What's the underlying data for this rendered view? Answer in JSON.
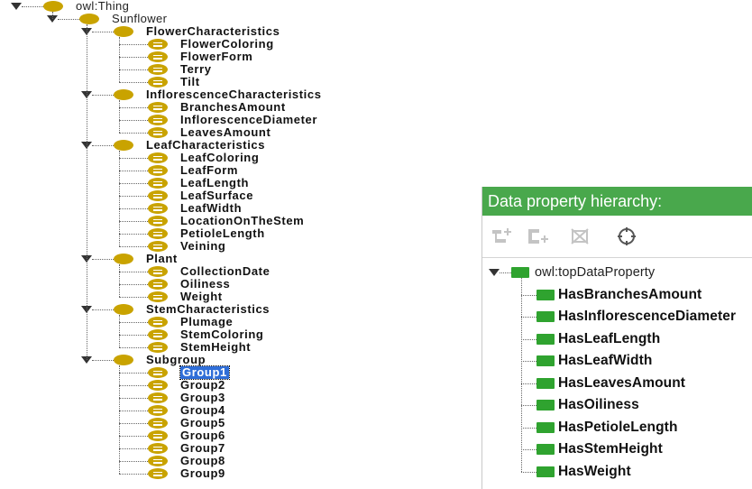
{
  "class_hierarchy": {
    "root": {
      "label": "owl:Thing"
    },
    "child": {
      "label": "Sunflower"
    },
    "groups": [
      {
        "label": "FlowerCharacteristics",
        "items": [
          "FlowerColoring",
          "FlowerForm",
          "Terry",
          "Tilt"
        ]
      },
      {
        "label": "InflorescenceCharacteristics",
        "items": [
          "BranchesAmount",
          "InflorescenceDiameter",
          "LeavesAmount"
        ]
      },
      {
        "label": "LeafCharacteristics",
        "items": [
          "LeafColoring",
          "LeafForm",
          "LeafLength",
          "LeafSurface",
          "LeafWidth",
          "LocationOnTheStem",
          "PetioleLength",
          "Veining"
        ]
      },
      {
        "label": "Plant",
        "items": [
          "CollectionDate",
          "Oiliness",
          "Weight"
        ]
      },
      {
        "label": "StemCharacteristics",
        "items": [
          "Plumage",
          "StemColoring",
          "StemHeight"
        ]
      },
      {
        "label": "Subgroup",
        "items": [
          "Group1",
          "Group2",
          "Group3",
          "Group4",
          "Group5",
          "Group6",
          "Group7",
          "Group8",
          "Group9"
        ]
      }
    ],
    "selected": "Group1"
  },
  "data_property_panel": {
    "title": "Data property hierarchy:",
    "toolbar": [
      {
        "icon": "add-subproperty-icon",
        "enabled": false
      },
      {
        "icon": "add-sibling-property-icon",
        "enabled": false
      },
      {
        "icon": "delete-property-icon",
        "enabled": false
      },
      {
        "icon": "locate-target-icon",
        "enabled": true
      }
    ],
    "root": {
      "label": "owl:topDataProperty"
    },
    "items": [
      "HasBranchesAmount",
      "HasInflorescenceDiameter",
      "HasLeafLength",
      "HasLeafWidth",
      "HasLeavesAmount",
      "HasOiliness",
      "HasPetioleLength",
      "HasStemHeight",
      "HasWeight"
    ]
  },
  "colors": {
    "class_icon": "#c9a300",
    "data_property_icon": "#2fa32f",
    "panel_header": "#49a84c",
    "selection": "#2f6ed8"
  }
}
